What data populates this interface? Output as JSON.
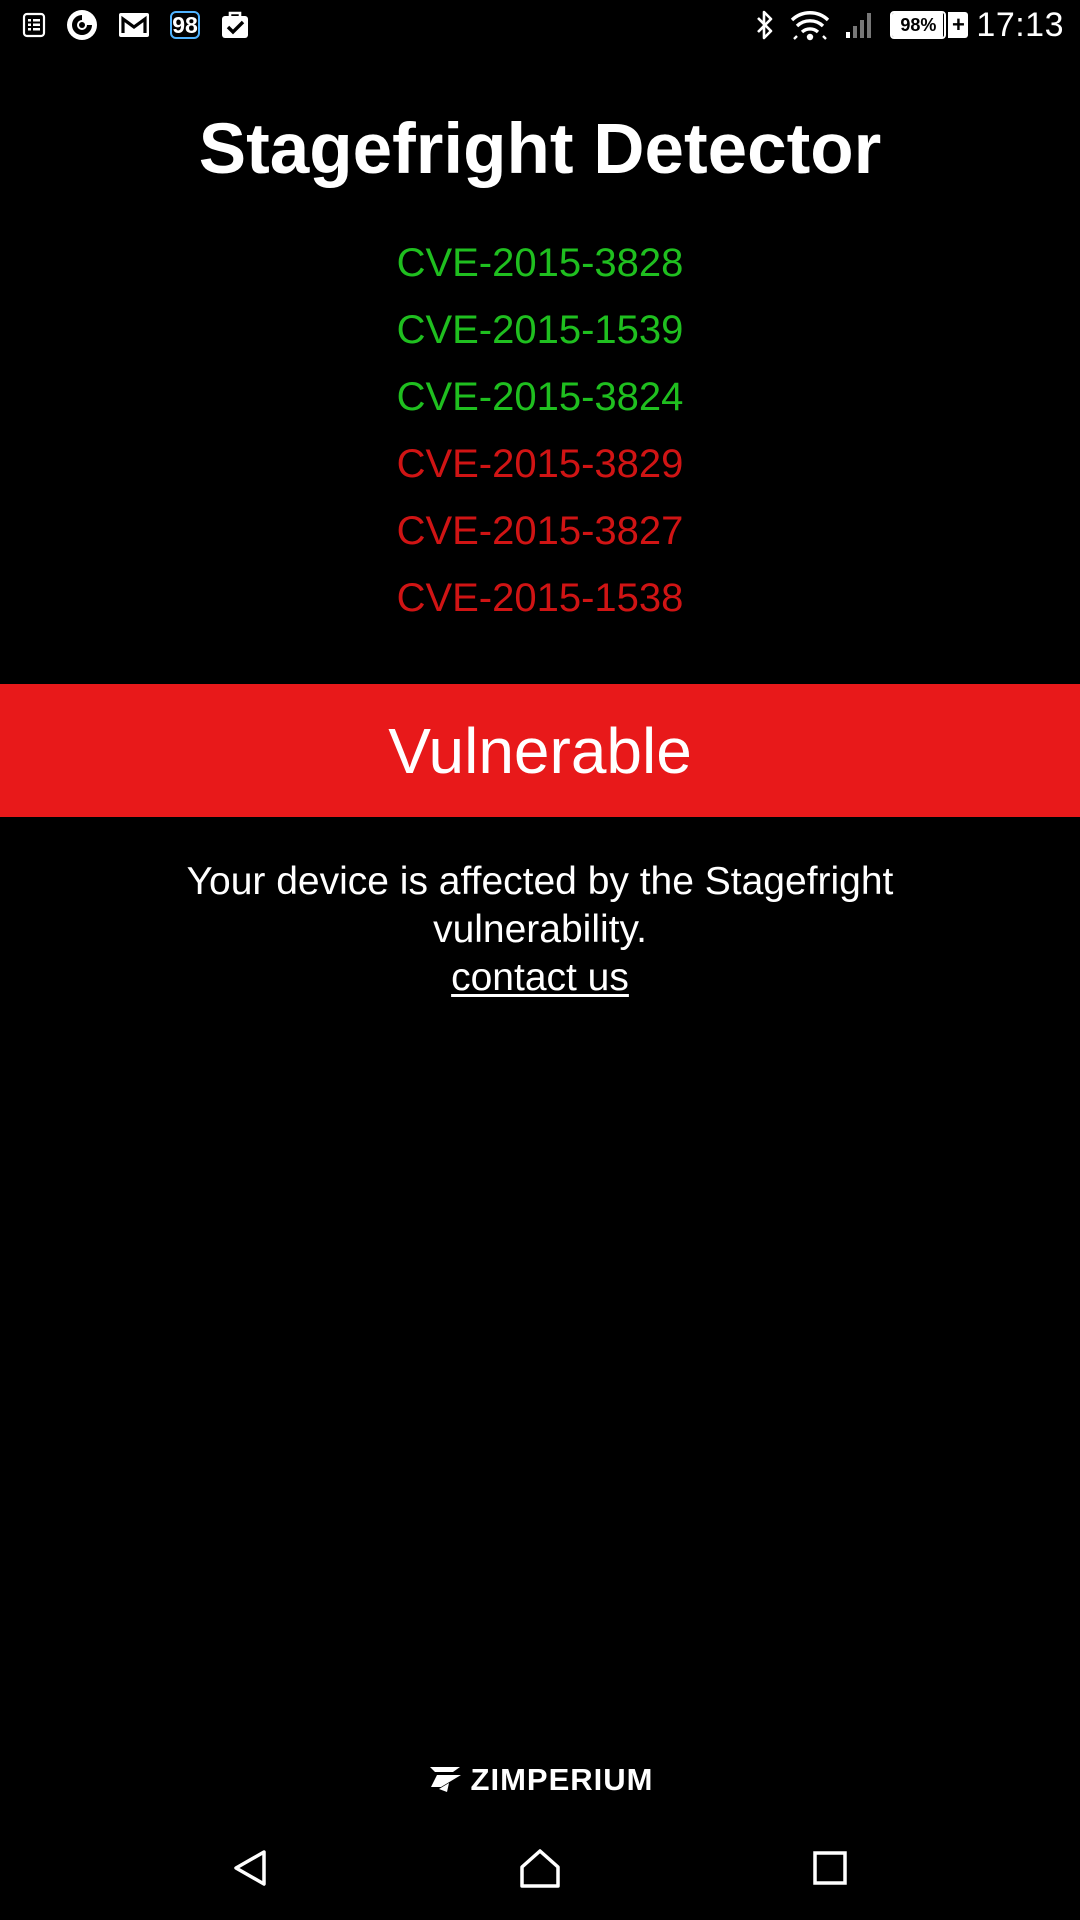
{
  "status_bar": {
    "left_icons": [
      "sheets-notification-icon",
      "circular-app-icon",
      "gmail-icon",
      "badge-notification-icon",
      "task-check-icon"
    ],
    "badge_text": "98",
    "right_icons": [
      "bluetooth-icon",
      "wifi-icon",
      "cellular-signal-icon"
    ],
    "battery_percent_text": "98%",
    "battery_level": 0.98,
    "time": "17:13"
  },
  "app": {
    "title": "Stagefright Detector",
    "cves": [
      {
        "id": "CVE-2015-3828",
        "status": "safe",
        "color": "#1fbf1f"
      },
      {
        "id": "CVE-2015-1539",
        "status": "safe",
        "color": "#1fbf1f"
      },
      {
        "id": "CVE-2015-3824",
        "status": "safe",
        "color": "#1fbf1f"
      },
      {
        "id": "CVE-2015-3829",
        "status": "vulnerable",
        "color": "#d01414"
      },
      {
        "id": "CVE-2015-3827",
        "status": "vulnerable",
        "color": "#d01414"
      },
      {
        "id": "CVE-2015-1538",
        "status": "vulnerable",
        "color": "#d01414"
      }
    ],
    "result": {
      "label": "Vulnerable",
      "banner_color": "#e8191a"
    },
    "message": "Your device is affected by the Stagefright vulnerability.",
    "contact_link": "contact us",
    "brand": "ZIMPERIUM"
  },
  "nav_bar": {
    "buttons": [
      "back-icon",
      "home-icon",
      "recents-icon"
    ]
  }
}
